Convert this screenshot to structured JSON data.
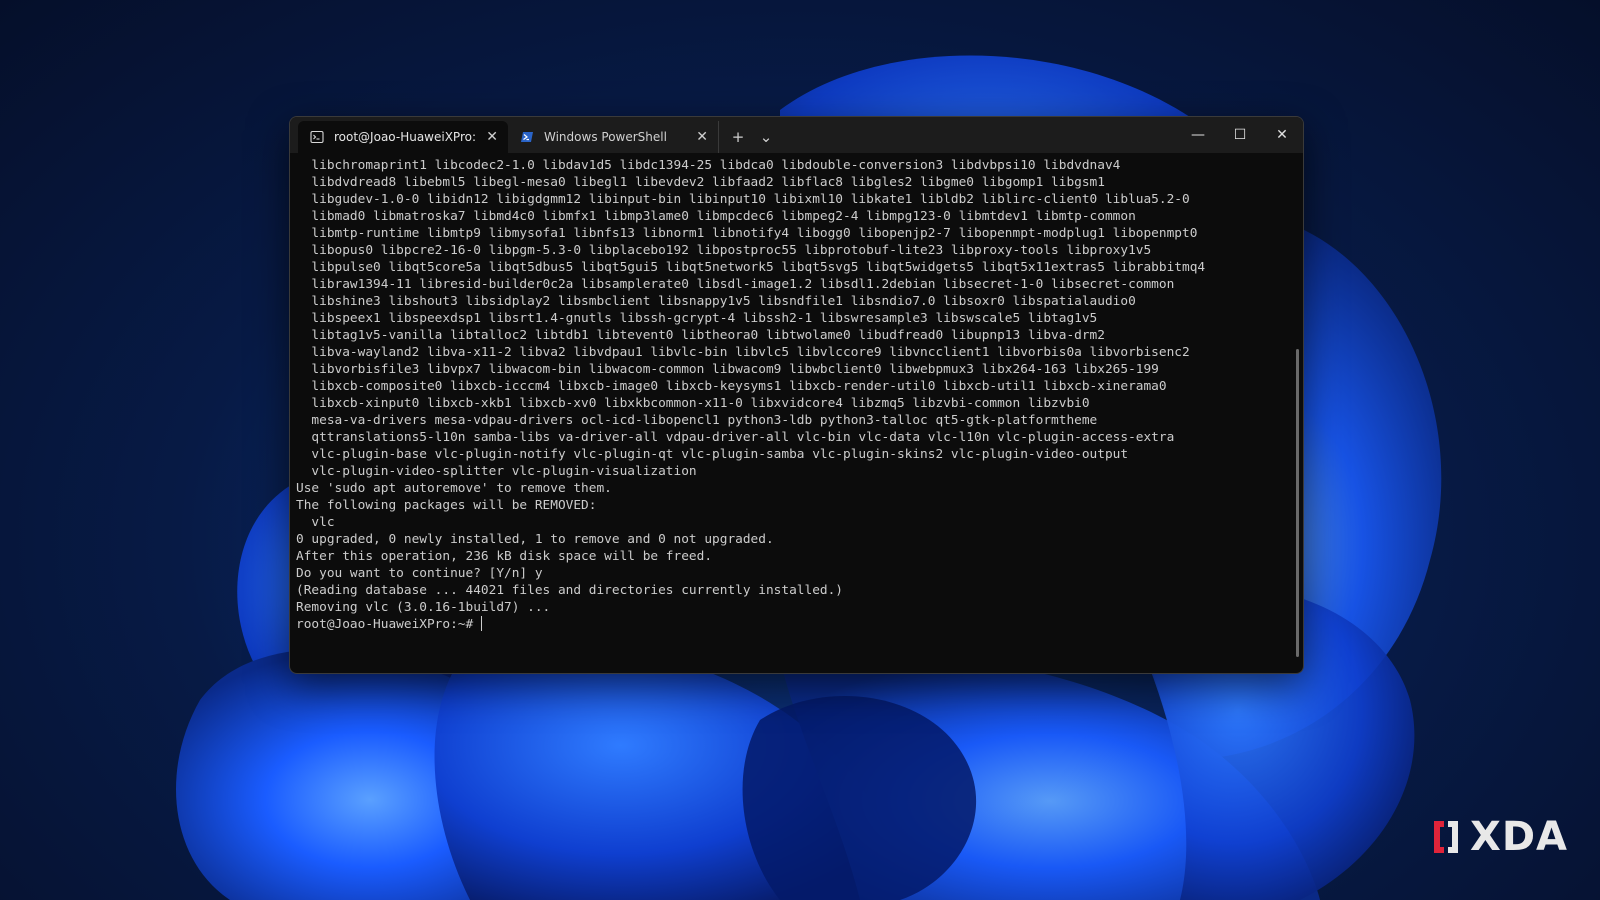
{
  "wallpaper": {
    "accent": "#1a5cff",
    "dark": "#050f2a"
  },
  "tabs": [
    {
      "title": "root@Joao-HuaweiXPro: ~",
      "icon": "linux-terminal-icon",
      "active": true
    },
    {
      "title": "Windows PowerShell",
      "icon": "powershell-icon",
      "active": false
    }
  ],
  "tab_actions": {
    "new_tab": "+",
    "dropdown": "⌄"
  },
  "window_controls": {
    "minimize": "—",
    "maximize": "☐",
    "close": "✕"
  },
  "console_lines": [
    "  libchromaprint1 libcodec2-1.0 libdav1d5 libdc1394-25 libdca0 libdouble-conversion3 libdvbpsi10 libdvdnav4",
    "  libdvdread8 libebml5 libegl-mesa0 libegl1 libevdev2 libfaad2 libflac8 libgles2 libgme0 libgomp1 libgsm1",
    "  libgudev-1.0-0 libidn12 libigdgmm12 libinput-bin libinput10 libixml10 libkate1 libldb2 liblirc-client0 liblua5.2-0",
    "  libmad0 libmatroska7 libmd4c0 libmfx1 libmp3lame0 libmpcdec6 libmpeg2-4 libmpg123-0 libmtdev1 libmtp-common",
    "  libmtp-runtime libmtp9 libmysofa1 libnfs13 libnorm1 libnotify4 libogg0 libopenjp2-7 libopenmpt-modplug1 libopenmpt0",
    "  libopus0 libpcre2-16-0 libpgm-5.3-0 libplacebo192 libpostproc55 libprotobuf-lite23 libproxy-tools libproxy1v5",
    "  libpulse0 libqt5core5a libqt5dbus5 libqt5gui5 libqt5network5 libqt5svg5 libqt5widgets5 libqt5x11extras5 librabbitmq4",
    "  libraw1394-11 libresid-builder0c2a libsamplerate0 libsdl-image1.2 libsdl1.2debian libsecret-1-0 libsecret-common",
    "  libshine3 libshout3 libsidplay2 libsmbclient libsnappy1v5 libsndfile1 libsndio7.0 libsoxr0 libspatialaudio0",
    "  libspeex1 libspeexdsp1 libsrt1.4-gnutls libssh-gcrypt-4 libssh2-1 libswresample3 libswscale5 libtag1v5",
    "  libtag1v5-vanilla libtalloc2 libtdb1 libtevent0 libtheora0 libtwolame0 libudfread0 libupnp13 libva-drm2",
    "  libva-wayland2 libva-x11-2 libva2 libvdpau1 libvlc-bin libvlc5 libvlccore9 libvncclient1 libvorbis0a libvorbisenc2",
    "  libvorbisfile3 libvpx7 libwacom-bin libwacom-common libwacom9 libwbclient0 libwebpmux3 libx264-163 libx265-199",
    "  libxcb-composite0 libxcb-icccm4 libxcb-image0 libxcb-keysyms1 libxcb-render-util0 libxcb-util1 libxcb-xinerama0",
    "  libxcb-xinput0 libxcb-xkb1 libxcb-xv0 libxkbcommon-x11-0 libxvidcore4 libzmq5 libzvbi-common libzvbi0",
    "  mesa-va-drivers mesa-vdpau-drivers ocl-icd-libopencl1 python3-ldb python3-talloc qt5-gtk-platformtheme",
    "  qttranslations5-l10n samba-libs va-driver-all vdpau-driver-all vlc-bin vlc-data vlc-l10n vlc-plugin-access-extra",
    "  vlc-plugin-base vlc-plugin-notify vlc-plugin-qt vlc-plugin-samba vlc-plugin-skins2 vlc-plugin-video-output",
    "  vlc-plugin-video-splitter vlc-plugin-visualization",
    "Use 'sudo apt autoremove' to remove them.",
    "The following packages will be REMOVED:",
    "  vlc",
    "0 upgraded, 0 newly installed, 1 to remove and 0 not upgraded.",
    "After this operation, 236 kB disk space will be freed.",
    "Do you want to continue? [Y/n] y",
    "(Reading database ... 44021 files and directories currently installed.)",
    "Removing vlc (3.0.16-1build7) ...",
    "root@Joao-HuaweiXPro:~# "
  ],
  "watermark": {
    "text": "XDA"
  }
}
